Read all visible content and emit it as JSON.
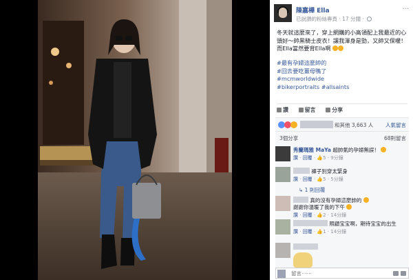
{
  "page": {
    "name": "陳嘉樺 Ella",
    "follow_status": "已說讚的粉絲專頁",
    "time_ago": "17 分鐘",
    "more": "···"
  },
  "post": {
    "line1": "冬天就這麼來了，穿上網購的小高領配上我最近的心頭好～帥黑騎士皮衣！讓我渾身是勁，又帥又保暖！而Ella當然要背Ella啊",
    "hashtags": [
      "#最有孕婦這麼帥的",
      "#回去要吃薑母鴨了",
      "#mcmworldwide",
      "#bikerportraits #allsaints"
    ]
  },
  "actions": {
    "like": "讚",
    "comment": "留言",
    "share": "分享"
  },
  "reactions": {
    "others_text": "和其他 3,663 人",
    "sort": "人氣留言"
  },
  "shares": {
    "share_count": "3個分享",
    "comment_count": "68則留言"
  },
  "comments": [
    {
      "name": "秀蘭瑪雅 MaYa",
      "text": "超帥氣的孕婦無誤！",
      "like": "讚",
      "reply": "回覆",
      "count": "5",
      "time": "9分鐘"
    },
    {
      "name": "",
      "text": "褲子別穿太緊身",
      "like": "讚",
      "reply": "回覆",
      "count": "5",
      "time": "5分鐘"
    },
    {
      "name": "",
      "text": "真的沒有孕婦這麼帥的",
      "text2": "謝謝你溫暖了我的下午",
      "like": "讚",
      "reply": "回覆",
      "count": "2",
      "time": "14分鐘"
    },
    {
      "name": "",
      "text": "照顧宝宝啊，期待宝宝的出生",
      "like": "讚",
      "reply": "回覆",
      "count": "1",
      "time": "14分鐘"
    }
  ],
  "reply_summary": "1 則回覆",
  "comment_box": {
    "placeholder": "留言⋯⋯"
  }
}
